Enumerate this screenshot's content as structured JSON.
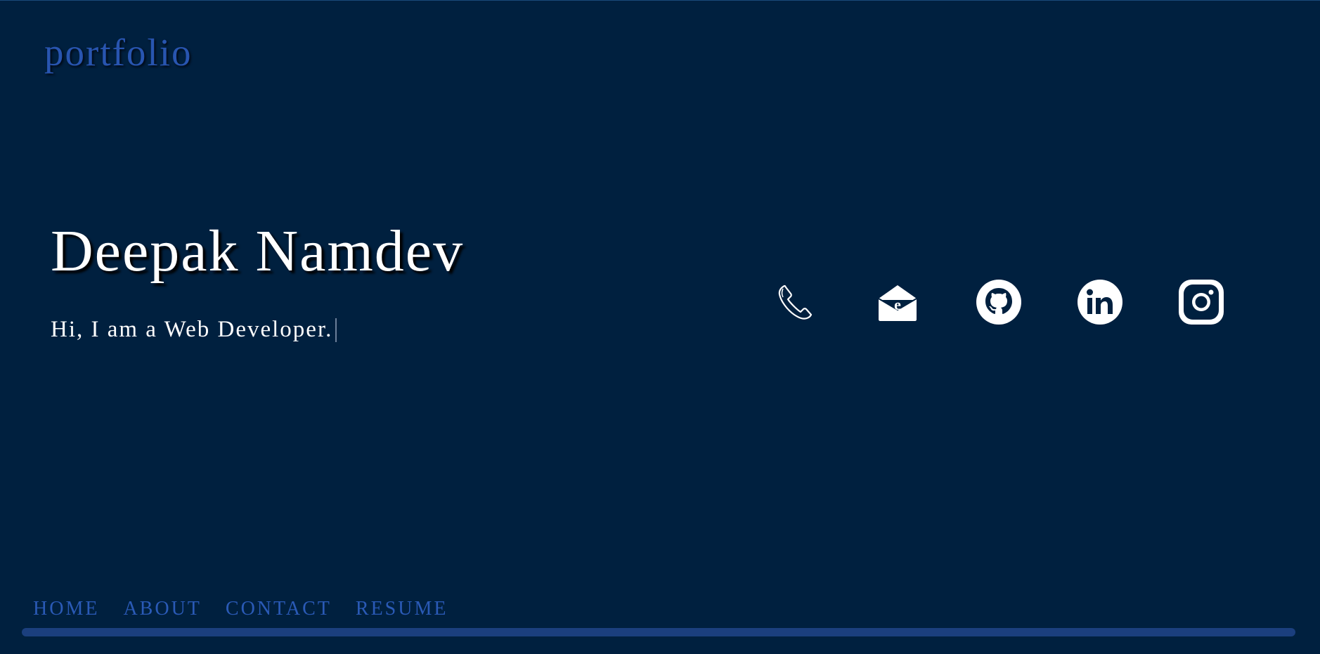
{
  "header": {
    "brand": "portfolio"
  },
  "hero": {
    "name": "Deepak Namdev",
    "tagline": "Hi, I am a Web Developer."
  },
  "socials": [
    {
      "icon": "phone-icon"
    },
    {
      "icon": "email-icon"
    },
    {
      "icon": "github-icon"
    },
    {
      "icon": "linkedin-icon"
    },
    {
      "icon": "instagram-icon"
    }
  ],
  "nav": {
    "items": [
      {
        "label": "HOME"
      },
      {
        "label": "ABOUT"
      },
      {
        "label": "CONTACT"
      },
      {
        "label": "RESUME"
      }
    ]
  },
  "colors": {
    "background": "#00203f",
    "accent": "#2855b0",
    "bar": "#1b3f7e",
    "text": "#ffffff"
  }
}
